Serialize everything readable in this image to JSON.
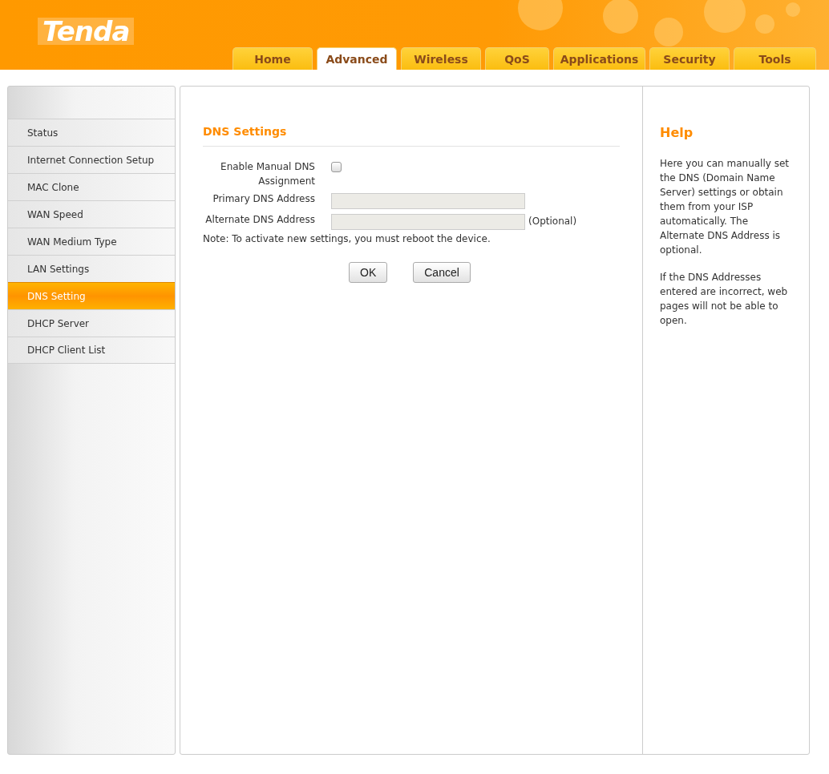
{
  "logo": "Tenda",
  "tabs": [
    {
      "label": "Home",
      "selected": false
    },
    {
      "label": "Advanced",
      "selected": true
    },
    {
      "label": "Wireless",
      "selected": false
    },
    {
      "label": "QoS",
      "selected": false
    },
    {
      "label": "Applications",
      "selected": false
    },
    {
      "label": "Security",
      "selected": false
    },
    {
      "label": "Tools",
      "selected": false
    }
  ],
  "sidebar": {
    "items": [
      {
        "label": "Status",
        "selected": false
      },
      {
        "label": "Internet Connection Setup",
        "selected": false
      },
      {
        "label": "MAC Clone",
        "selected": false
      },
      {
        "label": "WAN Speed",
        "selected": false
      },
      {
        "label": "WAN Medium Type",
        "selected": false
      },
      {
        "label": "LAN Settings",
        "selected": false
      },
      {
        "label": "DNS Setting",
        "selected": true
      },
      {
        "label": "DHCP Server",
        "selected": false
      },
      {
        "label": "DHCP Client List",
        "selected": false
      }
    ]
  },
  "form": {
    "title": "DNS Settings",
    "fields": [
      {
        "kind": "checkbox",
        "label": "Enable Manual DNS Assignment",
        "checked": false
      },
      {
        "kind": "text",
        "label": "Primary DNS Address",
        "disabled": true
      },
      {
        "kind": "text",
        "label": "Alternate DNS Address",
        "disabled": true,
        "suffix": "(Optional)"
      }
    ],
    "note": "Note: To activate new settings, you must reboot the device.",
    "buttons": [
      "OK",
      "Cancel"
    ]
  },
  "help": {
    "title": "Help",
    "paragraphs": [
      "Here you can manually set the DNS (Domain Name Server) settings or obtain them from your ISP automatically. The Alternate DNS Address is optional.",
      "If the DNS Addresses entered are incorrect, web pages will not be able to open."
    ]
  }
}
